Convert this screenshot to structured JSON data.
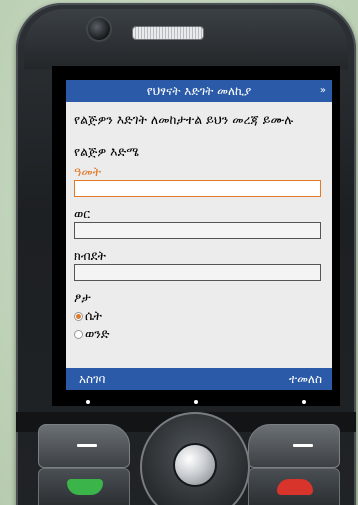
{
  "app": {
    "title": "የህፃናት እድገት መለኪያ",
    "more_indicator": "»"
  },
  "form": {
    "instruction": "የልጅዎን እድገት ለመከታተል ይህን መረጃ ይሙሉ",
    "section_heading": "የልጅዎ እድሜ",
    "fields": [
      {
        "label": "ዓመት",
        "value": "",
        "focused": true
      },
      {
        "label": "ወር",
        "value": "",
        "focused": false
      },
      {
        "label": "ክብደት",
        "value": "",
        "focused": false
      }
    ],
    "gender": {
      "label": "ፆታ",
      "options": [
        {
          "label": "ሴት",
          "selected": true
        },
        {
          "label": "ወንድ",
          "selected": false
        }
      ]
    }
  },
  "softkeys": {
    "left": "አስገባ",
    "right": "ተመለስ"
  },
  "colors": {
    "accent_bar": "#2a5aa8",
    "focus": "#e07a2a",
    "screen_bg": "#ececec"
  },
  "icons": {
    "call": "green-handset-icon",
    "end": "red-handset-icon",
    "camera": "camera-lens-icon",
    "speaker": "speaker-grill-icon"
  }
}
